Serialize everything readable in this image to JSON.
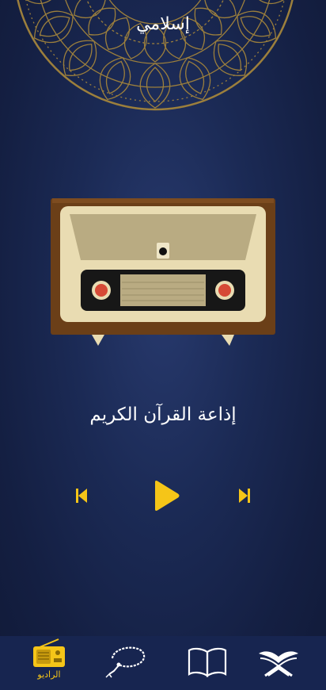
{
  "header": {
    "title": "إسلامي"
  },
  "player": {
    "station_name": "إذاعة القرآن الكريم",
    "prev_icon": "skip-previous-icon",
    "play_icon": "play-icon",
    "next_icon": "skip-next-icon"
  },
  "bottom_nav": {
    "items": [
      {
        "label": "الراديو",
        "icon": "radio-icon",
        "active": true
      },
      {
        "label": "",
        "icon": "tasbeeh-icon",
        "active": false
      },
      {
        "label": "",
        "icon": "open-book-icon",
        "active": false
      },
      {
        "label": "",
        "icon": "quran-icon",
        "active": false
      }
    ]
  },
  "colors": {
    "accent": "#f5c518",
    "background": "#1b2a55",
    "nav": "#172550"
  }
}
